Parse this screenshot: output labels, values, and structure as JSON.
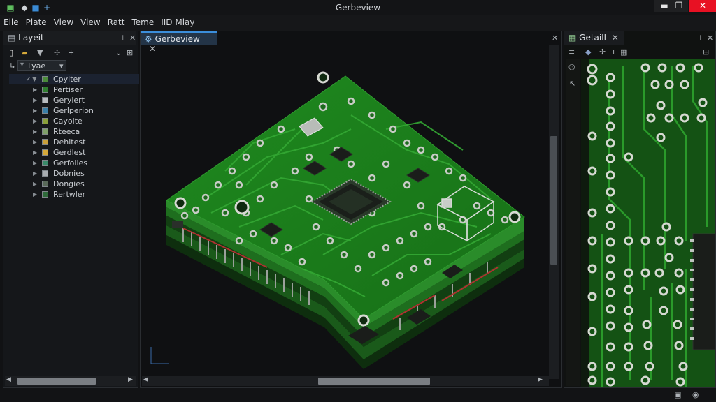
{
  "window": {
    "title": "Gerbeview",
    "buttons": [
      "▬",
      "❐",
      "✕"
    ]
  },
  "menu": [
    "Elle",
    "Plate",
    "View",
    "View",
    "Ratt",
    "Teme",
    "IID Mlay"
  ],
  "left_panel": {
    "tab_label": "Layeit",
    "filter_label": "Lyae",
    "layers": [
      {
        "label": "Cpyiter",
        "color": "#4a8a3a",
        "expanded": true
      },
      {
        "label": "Pertiser",
        "color": "#2f7d2f"
      },
      {
        "label": "Gerylert",
        "color": "#b8bcc0"
      },
      {
        "label": "Gerlperion",
        "color": "#3a7fa8"
      },
      {
        "label": "Cayolte",
        "color": "#8aa03a"
      },
      {
        "label": "Rteeca",
        "color": "#7fa06a"
      },
      {
        "label": "Dehltest",
        "color": "#c9a03a"
      },
      {
        "label": "Gerdlest",
        "color": "#d4a83a"
      },
      {
        "label": "Gerfoiles",
        "color": "#3a8a6a"
      },
      {
        "label": "Dobnies",
        "color": "#a8acb0"
      },
      {
        "label": "Dongies",
        "color": "#5a6a5a"
      },
      {
        "label": "Rertwler",
        "color": "#2f6a3a"
      }
    ]
  },
  "center_panel": {
    "tab_label": "Gerbeview"
  },
  "right_panel": {
    "tab_label": "Getaill"
  },
  "colors": {
    "pcb_green": "#1f7a1f",
    "pcb_dark": "#145a14",
    "pad": "#c8ccc6",
    "accent_tab": "#2d3a4a"
  }
}
